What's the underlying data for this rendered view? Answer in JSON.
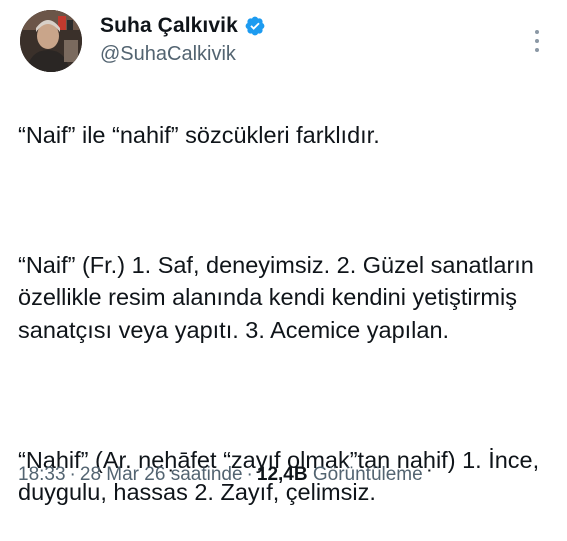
{
  "author": {
    "display_name": "Suha Çalkıvik",
    "handle": "@SuhaCalkivik",
    "verified_icon": "verified-badge-icon",
    "badge_color": "#1d9bf0"
  },
  "tweet": {
    "paragraphs": [
      "“Naif” ile “nahif” sözcükleri farklıdır.",
      "“Naif” (Fr.) 1. Saf, deneyimsiz. 2. Güzel sanatların özellikle resim alanında kendi kendini yetiştirmiş sanatçısı veya yapıtı. 3. Acemice yapılan.",
      "“Nahif” (Ar. neḥāfet “zayıf olmak”tan naḥif) 1. İnce, duygulu, hassas 2. Zayıf, çelimsiz."
    ]
  },
  "meta": {
    "time": "18:33",
    "date": "28 Mar 26 saatinde",
    "views_count": "12,4B",
    "views_label": "Görüntüleme",
    "separator": "·"
  }
}
